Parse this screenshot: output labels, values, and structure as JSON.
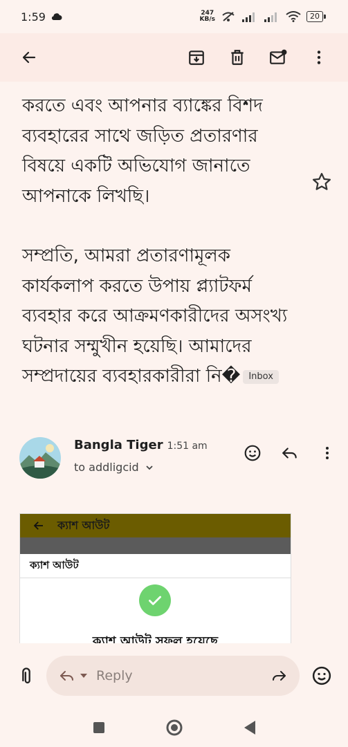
{
  "status_bar": {
    "time": "1:59",
    "net_speed_value": "247",
    "net_speed_unit": "KB/s",
    "battery": "20"
  },
  "toolbar": {
    "back_icon": "arrow-back-icon",
    "archive_icon": "archive-icon",
    "delete_icon": "trash-icon",
    "mark_unread_icon": "mail-unread-icon",
    "more_icon": "more-vert-icon"
  },
  "email": {
    "body_lines_1": "করতে এবং আপনার ব্যাঙ্কের বিশদ ব্যবহারের সাথে জড়িত প্রতারণার বিষয়ে একটি অভিযোগ জানাতে আপনাকে লিখছি।",
    "body_lines_2": "সম্প্রতি, আমরা প্রতারণামূলক কার্যকলাপ করতে উপায় প্ল্যাটফর্ম ব্যবহার করে আক্রমণকারীদের অসংখ্য ঘটনার সম্মুখীন হয়েছি। আমাদের সম্প্রদায়ের ব্যবহারকারীরা নি�",
    "label_chip": "Inbox"
  },
  "message": {
    "sender_name": "Bangla Tiger",
    "time": "1:51 am",
    "recipient": "to addligcid"
  },
  "attachment": {
    "top_bar_title": "ক্যাশ আউট",
    "header_title": "ক্যাশ আউট",
    "success_text": "ক্যাশ আউট সফল হয়েছে"
  },
  "compose": {
    "reply_placeholder": "Reply"
  },
  "colors": {
    "background": "#fdf3ef",
    "success_green": "#6ed36f",
    "attachment_bar": "#6b5c00"
  }
}
